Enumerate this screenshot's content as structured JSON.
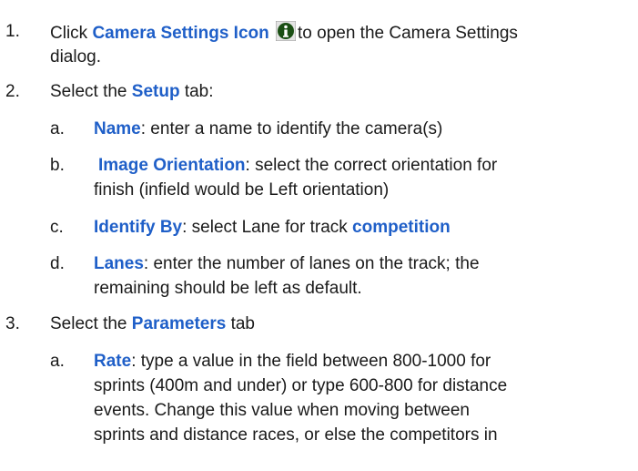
{
  "steps": [
    {
      "num": "1.",
      "lines": [
        {
          "pre": "Click ",
          "kw": "Camera Settings Icon",
          "post": "to open the Camera Settings"
        },
        {
          "text": "dialog."
        }
      ],
      "icon": "info-icon"
    },
    {
      "num": "2.",
      "line": {
        "pre": "Select the ",
        "kw": "Setup",
        "post": " tab:"
      },
      "sub": [
        {
          "letter": "a.",
          "line1": {
            "kw": "Name",
            "post": ": enter a name to identify the camera(s)"
          }
        },
        {
          "letter": "b.",
          "line1": {
            "kw": "Image Orientation",
            "post": ": select the correct orientation for"
          },
          "line2": "finish (infield would be Left orientation)"
        },
        {
          "letter": "c.",
          "line1": {
            "kw": "Identify By",
            "post": ": select Lane for track ",
            "kw2": "competition"
          }
        },
        {
          "letter": "d.",
          "line1": {
            "kw": "Lanes",
            "post": ": enter the number of lanes on the track; the"
          },
          "line2": "remaining should be left as default."
        }
      ]
    },
    {
      "num": "3.",
      "line": {
        "pre": "Select the ",
        "kw": "Parameters",
        "post": " tab"
      },
      "sub": [
        {
          "letter": "a.",
          "line1": {
            "kw": "Rate",
            "post": ": type a value in the field between 800-1000 for"
          },
          "line2": "sprints (400m and under) or type 600-800 for distance",
          "line3": "events. Change this value when moving between",
          "line4": "sprints and distance races, or else the competitors in"
        }
      ]
    }
  ],
  "colors": {
    "keyword": "#1f5fc8",
    "text": "#1a1a1a",
    "icon_bg": "#1a4f14"
  }
}
